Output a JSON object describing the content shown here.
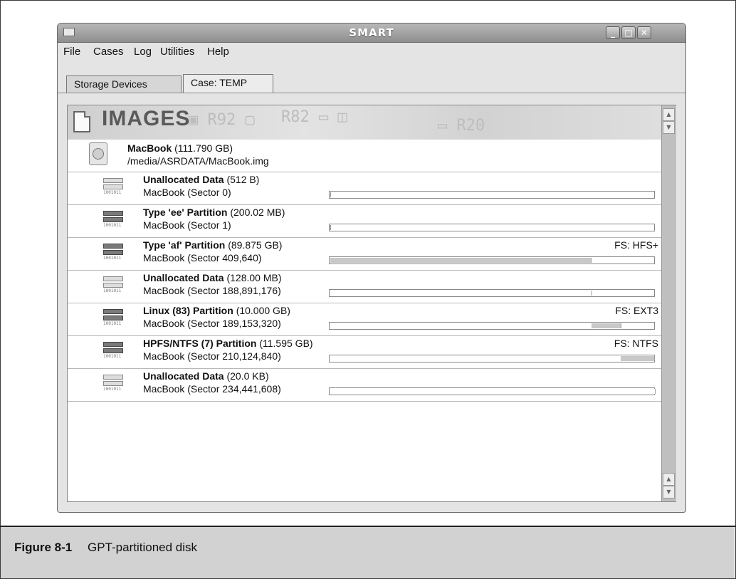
{
  "window": {
    "title": "SMART",
    "controls": [
      "minimize",
      "maximize",
      "close"
    ]
  },
  "menubar": [
    "File",
    "Cases",
    "Log",
    "Utilities",
    "Help"
  ],
  "tabs": [
    {
      "label": "Storage Devices",
      "active": false
    },
    {
      "label": "Case: TEMP",
      "active": true
    }
  ],
  "panel": {
    "heading": "IMAGES",
    "disk": {
      "name": "MacBook",
      "size": "(111.790 GB)",
      "path": "/media/ASRDATA/MacBook.img"
    },
    "partitions": [
      {
        "name": "Unallocated Data",
        "size": "(512 B)",
        "location": "MacBook (Sector 0)",
        "fs": "",
        "fill_start": 0,
        "fill_end": 0,
        "allocated": false
      },
      {
        "name": "Type 'ee' Partition",
        "size": "(200.02 MB)",
        "location": "MacBook (Sector 1)",
        "fs": "",
        "fill_start": 0,
        "fill_end": 0.002,
        "allocated": true
      },
      {
        "name": "Type 'af' Partition",
        "size": "(89.875 GB)",
        "location": "MacBook (Sector 409,640)",
        "fs": "FS: HFS+",
        "fill_start": 0.002,
        "fill_end": 0.804,
        "allocated": true
      },
      {
        "name": "Unallocated Data",
        "size": "(128.00 MB)",
        "location": "MacBook (Sector 188,891,176)",
        "fs": "",
        "fill_start": 0.804,
        "fill_end": 0.806,
        "allocated": false
      },
      {
        "name": "Linux (83) Partition",
        "size": "(10.000 GB)",
        "location": "MacBook (Sector 189,153,320)",
        "fs": "FS: EXT3",
        "fill_start": 0.806,
        "fill_end": 0.896,
        "allocated": true
      },
      {
        "name": "HPFS/NTFS (7) Partition",
        "size": "(11.595 GB)",
        "location": "MacBook (Sector 210,124,840)",
        "fs": "FS: NTFS",
        "fill_start": 0.896,
        "fill_end": 1.0,
        "allocated": true
      },
      {
        "name": "Unallocated Data",
        "size": "(20.0 KB)",
        "location": "MacBook (Sector 234,441,608)",
        "fs": "",
        "fill_start": 0.9995,
        "fill_end": 1.0,
        "allocated": false
      }
    ]
  },
  "figure": {
    "label": "Figure 8-1",
    "caption": "GPT-partitioned disk"
  }
}
